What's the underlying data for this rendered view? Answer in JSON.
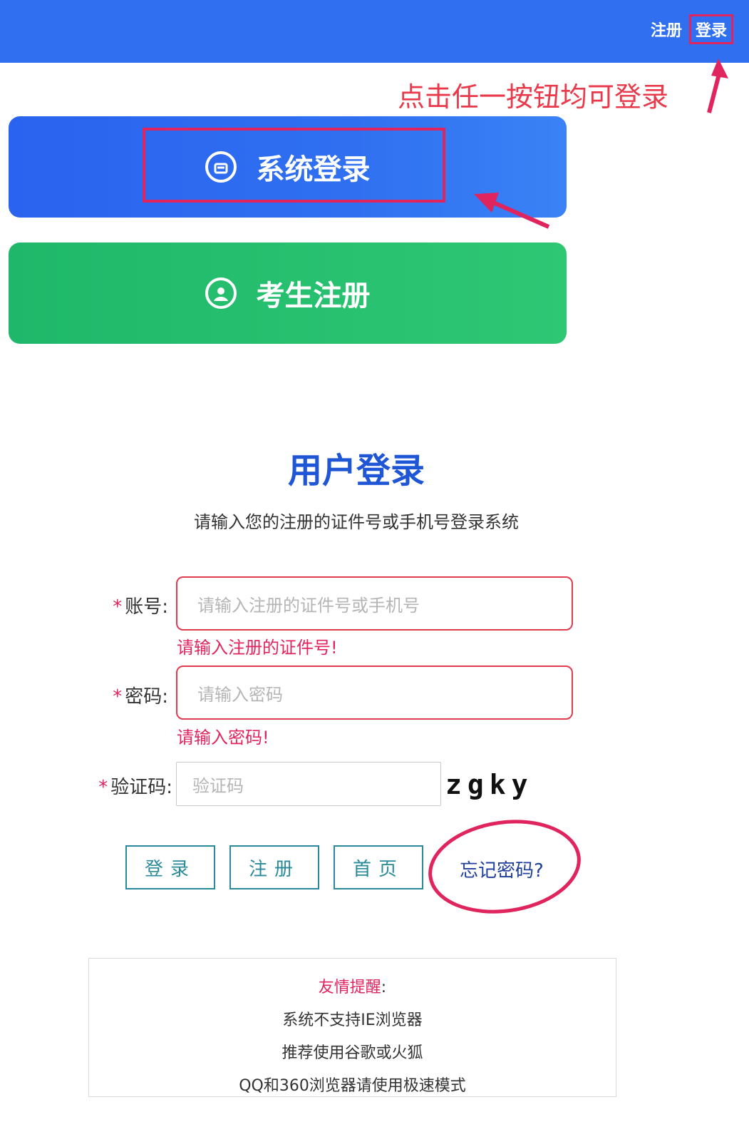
{
  "header": {
    "register_label": "注册",
    "login_label": "登录"
  },
  "annotation": {
    "text": "点击任一按钮均可登录"
  },
  "buttons": {
    "system_login": "系统登录",
    "exam_register": "考生注册"
  },
  "form": {
    "title": "用户登录",
    "subtitle": "请输入您的注册的证件号或手机号登录系统",
    "account": {
      "label": "账号:",
      "placeholder": "请输入注册的证件号或手机号",
      "error": "请输入注册的证件号!"
    },
    "password": {
      "label": "密码:",
      "placeholder": "请输入密码",
      "error": "请输入密码!"
    },
    "captcha": {
      "label": "验证码:",
      "placeholder": "验证码",
      "image_text": "zgky"
    },
    "required_mark": "*",
    "actions": {
      "login": "登录",
      "register": "注册",
      "home": "首页",
      "forgot": "忘记密码?"
    }
  },
  "notice": {
    "title": "友情提醒",
    "colon": ":",
    "lines": [
      "系统不支持IE浏览器",
      "推荐使用谷歌或火狐",
      "QQ和360浏览器请使用极速模式"
    ]
  },
  "colors": {
    "brand_blue": "#2f6ff0",
    "brand_green": "#2ec774",
    "annotation_red": "#e0245e",
    "title_blue": "#1f56d6",
    "action_teal": "#2a8a9a"
  }
}
